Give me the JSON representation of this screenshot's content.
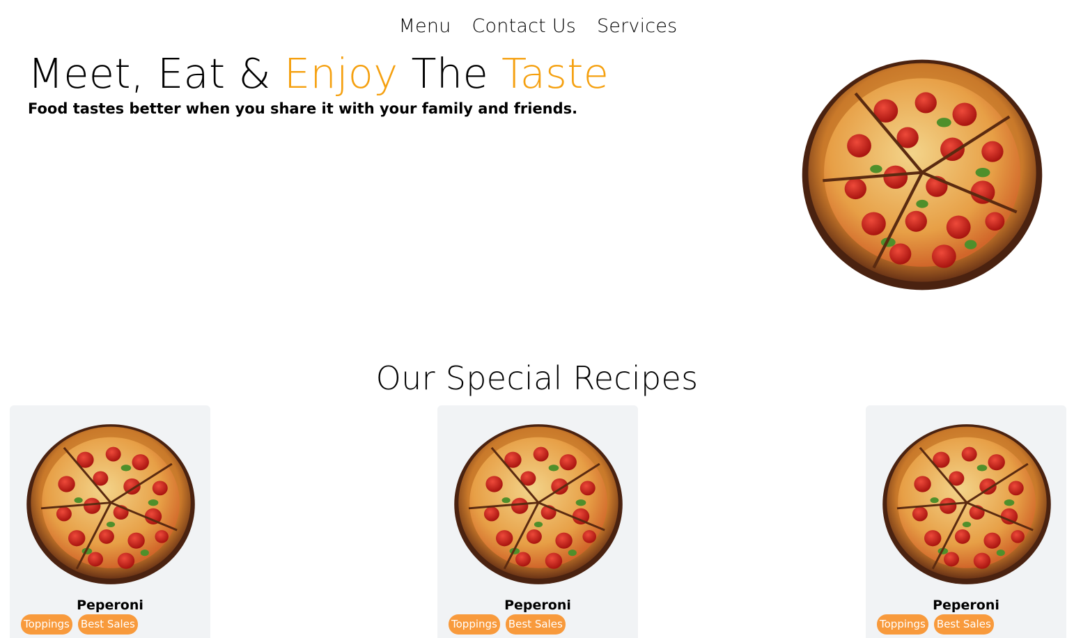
{
  "nav": {
    "items": [
      {
        "label": "Menu"
      },
      {
        "label": "Contact Us"
      },
      {
        "label": "Services"
      }
    ]
  },
  "hero": {
    "title_part1": "Meet, Eat & ",
    "title_accent1": "Enjoy",
    "title_part2": " The ",
    "title_accent2": "Taste",
    "subtitle": "Food tastes better when you share it with your family and friends.",
    "image_icon": "pizza-image"
  },
  "recipes": {
    "title": "Our Special Recipes",
    "cards": [
      {
        "name": "Peperoni",
        "tags": [
          "Toppings",
          "Best Sales"
        ]
      },
      {
        "name": "Peperoni",
        "tags": [
          "Toppings",
          "Best Sales"
        ]
      },
      {
        "name": "Peperoni",
        "tags": [
          "Toppings",
          "Best Sales"
        ]
      }
    ]
  },
  "colors": {
    "accent": "#f5a00f",
    "tag_bg": "#f89a3c",
    "card_bg": "#f1f3f5"
  }
}
